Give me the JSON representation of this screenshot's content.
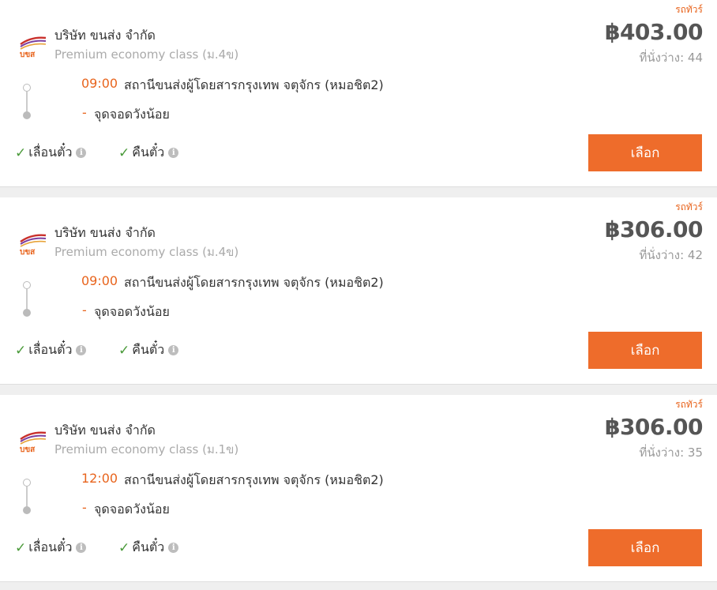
{
  "trips": [
    {
      "bus_type": "รถทัวร์",
      "company": "บริษัท ขนส่ง จำกัด",
      "class": "Premium economy class (ม.4ข)",
      "price": "฿403.00",
      "seats": "ที่นั่งว่าง: 44",
      "departure_time": "09:00",
      "origin": "สถานีขนส่งผู้โดยสารกรุงเทพ จตุจักร (หมอชิต2)",
      "dash": "-",
      "destination": "จุดจอดวังน้อย",
      "feature1": "เลื่อนตั๋ว",
      "feature2": "คืนตั๋ว",
      "select_label": "เลือก"
    },
    {
      "bus_type": "รถทัวร์",
      "company": "บริษัท ขนส่ง จำกัด",
      "class": "Premium economy class (ม.4ข)",
      "price": "฿306.00",
      "seats": "ที่นั่งว่าง: 42",
      "departure_time": "09:00",
      "origin": "สถานีขนส่งผู้โดยสารกรุงเทพ จตุจักร (หมอชิต2)",
      "dash": "-",
      "destination": "จุดจอดวังน้อย",
      "feature1": "เลื่อนตั๋ว",
      "feature2": "คืนตั๋ว",
      "select_label": "เลือก"
    },
    {
      "bus_type": "รถทัวร์",
      "company": "บริษัท ขนส่ง จำกัด",
      "class": "Premium economy class (ม.1ข)",
      "price": "฿306.00",
      "seats": "ที่นั่งว่าง: 35",
      "departure_time": "12:00",
      "origin": "สถานีขนส่งผู้โดยสารกรุงเทพ จตุจักร (หมอชิต2)",
      "dash": "-",
      "destination": "จุดจอดวังน้อย",
      "feature1": "เลื่อนตั๋ว",
      "feature2": "คืนตั๋ว",
      "select_label": "เลือก"
    }
  ],
  "logo_text": "บขส",
  "icons": {
    "check": "check-icon",
    "info": "info-icon"
  },
  "colors": {
    "accent": "#ee6c2b",
    "time": "#e8641d",
    "check": "#4a9a3a"
  }
}
